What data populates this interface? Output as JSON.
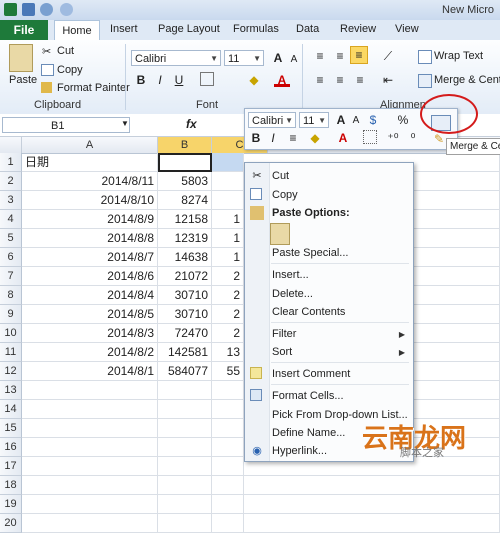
{
  "app": {
    "title": "New Micro"
  },
  "ribbon_tabs": [
    "File",
    "Home",
    "Insert",
    "Page Layout",
    "Formulas",
    "Data",
    "Review",
    "View"
  ],
  "clipboard": {
    "paste": "Paste",
    "cut": "Cut",
    "copy": "Copy",
    "format_painter": "Format Painter",
    "group": "Clipboard"
  },
  "font": {
    "name": "Calibri",
    "size": "11",
    "group": "Font",
    "bold": "B",
    "italic": "I",
    "underline": "U"
  },
  "alignment": {
    "wrap_text": "Wrap Text",
    "merge": "Merge & Cente",
    "group": "Alignmen"
  },
  "formula_bar": {
    "name_box": "B1",
    "fx": "fx"
  },
  "columns": [
    "A",
    "B",
    "C"
  ],
  "rows": [
    {
      "n": "1",
      "a": "日期",
      "b": ""
    },
    {
      "n": "2",
      "a": "2014/8/11",
      "b": "5803"
    },
    {
      "n": "3",
      "a": "2014/8/10",
      "b": "8274"
    },
    {
      "n": "4",
      "a": "2014/8/9",
      "b": "12158"
    },
    {
      "n": "5",
      "a": "2014/8/8",
      "b": "12319"
    },
    {
      "n": "6",
      "a": "2014/8/7",
      "b": "14638"
    },
    {
      "n": "7",
      "a": "2014/8/6",
      "b": "21072"
    },
    {
      "n": "8",
      "a": "2014/8/4",
      "b": "30710"
    },
    {
      "n": "9",
      "a": "2014/8/5",
      "b": "30710"
    },
    {
      "n": "10",
      "a": "2014/8/3",
      "b": "72470"
    },
    {
      "n": "11",
      "a": "2014/8/2",
      "b": "142581"
    },
    {
      "n": "12",
      "a": "2014/8/1",
      "b": "584077"
    },
    {
      "n": "13",
      "a": "",
      "b": ""
    },
    {
      "n": "14",
      "a": "",
      "b": ""
    },
    {
      "n": "15",
      "a": "",
      "b": ""
    },
    {
      "n": "16",
      "a": "",
      "b": ""
    },
    {
      "n": "17",
      "a": "",
      "b": ""
    },
    {
      "n": "18",
      "a": "",
      "b": ""
    },
    {
      "n": "19",
      "a": "",
      "b": ""
    },
    {
      "n": "20",
      "a": "",
      "b": ""
    }
  ],
  "col_c_partial": {
    "4": "1",
    "5": "1",
    "6": "1",
    "7": "2",
    "8": "2",
    "9": "2",
    "10": "2",
    "11": "13",
    "12": "55"
  },
  "mini_toolbar": {
    "font": "Calibri",
    "size": "11",
    "percent": "%",
    "bold": "B",
    "italic": "I"
  },
  "tooltip": "Merge & Ce",
  "context_menu": {
    "cut": "Cut",
    "copy": "Copy",
    "paste_options": "Paste Options:",
    "paste_special": "Paste Special...",
    "insert": "Insert...",
    "delete": "Delete...",
    "clear_contents": "Clear Contents",
    "filter": "Filter",
    "sort": "Sort",
    "insert_comment": "Insert Comment",
    "format_cells": "Format Cells...",
    "pick_list": "Pick From Drop-down List...",
    "define_name": "Define Name...",
    "hyperlink": "Hyperlink..."
  },
  "watermark": {
    "main": "云南龙网",
    "sub": "脚本之家"
  },
  "colors": {
    "file_tab": "#1e7a3a",
    "highlight": "#d41b1b",
    "selection": "#fbd864"
  }
}
